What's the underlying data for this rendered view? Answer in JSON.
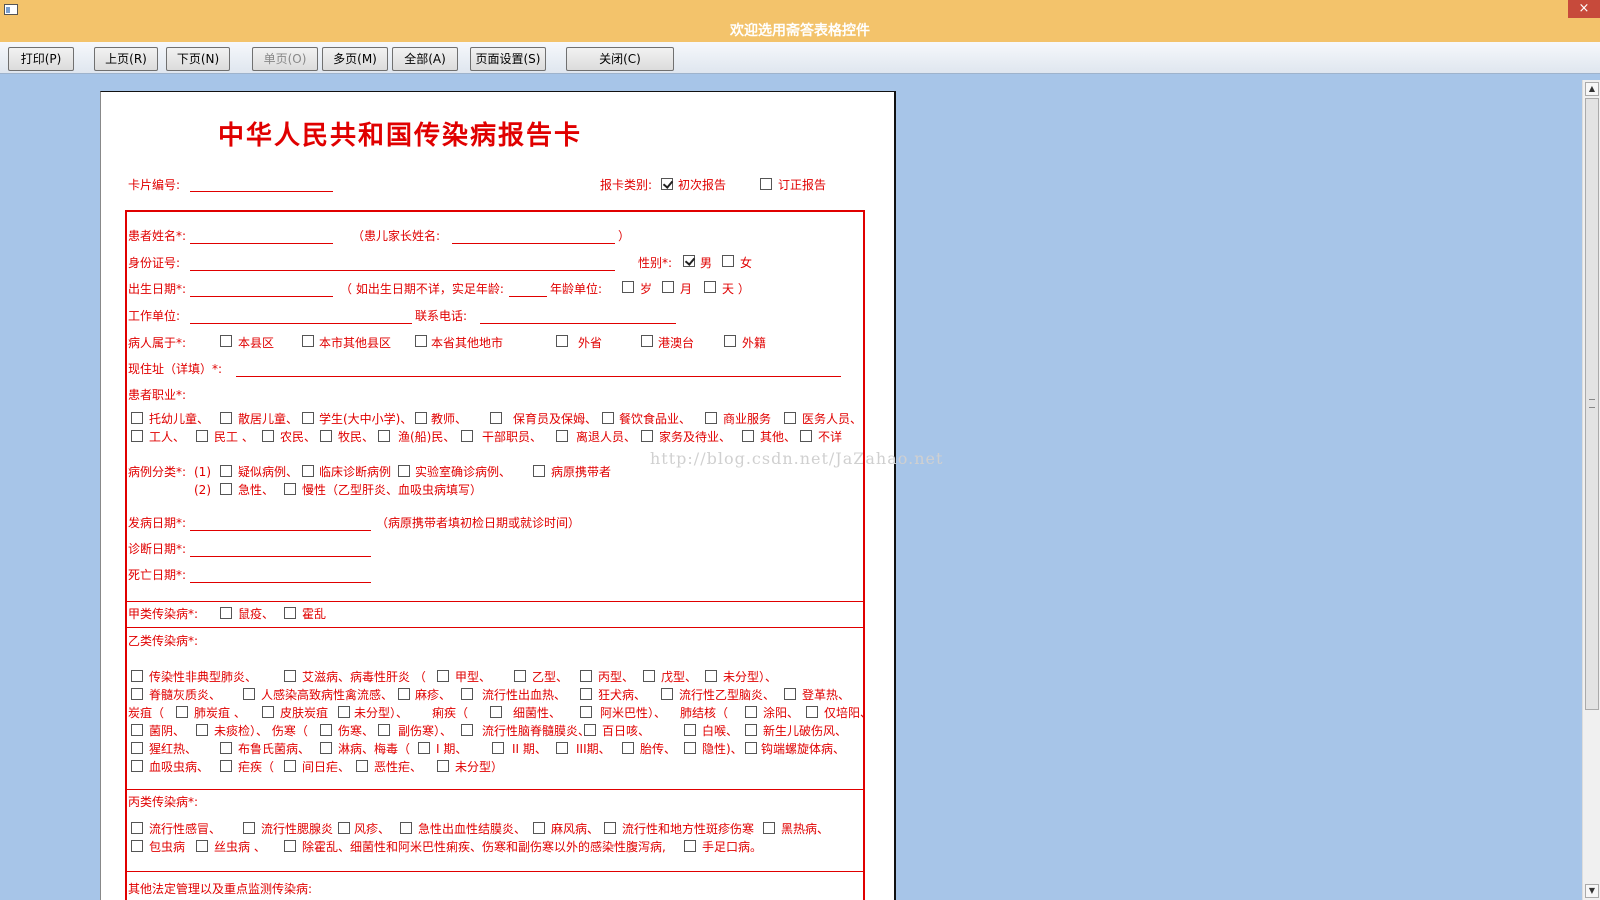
{
  "window": {
    "title": "欢迎选用斋答表格控件",
    "close_label": "×"
  },
  "toolbar": {
    "print": "打印(P)",
    "prev": "上页(R)",
    "next": "下页(N)",
    "single": "单页(O)",
    "multi": "多页(M)",
    "all": "全部(A)",
    "page_setup": "页面设置(S)",
    "close": "关闭(C)"
  },
  "doc": {
    "title": "中华人民共和国传染病报告卡",
    "card_no_label": "卡片编号:",
    "report_type_label": "报卡类别:",
    "initial_report": "初次报告",
    "revised_report": "订正报告",
    "patient_name_label": "患者姓名*:",
    "guardian_label": "（患儿家长姓名:",
    "close_paren": "）",
    "id_label": "身份证号:",
    "sex_label": "性别*:",
    "male": "男",
    "female": "女",
    "birth_label": "出生日期*:",
    "birth_note": "（ 如出生日期不详，实足年龄:",
    "age_unit_label": "年龄单位:",
    "year": "岁",
    "month": "月",
    "day": "天 ）",
    "work_label": "工作单位:",
    "phone_label": "联系电话:",
    "belong_label": "病人属于*:",
    "belong_opts": [
      "本县区",
      "本市其他县区",
      "本省其他地市",
      "外省",
      "港澳台",
      "外籍"
    ],
    "address_label": "现住址（详填）*:",
    "occupation_label": "患者职业*:",
    "occ_row1": [
      "托幼儿童、",
      "散居儿童、",
      "学生(大中小学)、",
      "教师、",
      "保育员及保姆、",
      "餐饮食品业、",
      "商业服务",
      "医务人员、"
    ],
    "occ_row2": [
      "工人、",
      "民工 、",
      "农民、",
      "牧民、",
      "渔(船)民、",
      "干部职员、",
      "离退人员、",
      "家务及待业、",
      "其他、",
      "不详"
    ],
    "case_class_label": "病例分类*:",
    "cc_1": "(1)",
    "cc_2": "(2)",
    "cc_row1": [
      "疑似病例、",
      "临床诊断病例",
      "实验室确诊病例、",
      "病原携带者"
    ],
    "cc_row2": [
      "急性、",
      "慢性（乙型肝炎、血吸虫病填写）"
    ],
    "onset_label": "发病日期*:",
    "onset_note": "（病原携带者填初检日期或就诊时间）",
    "diag_label": "诊断日期*:",
    "death_label": "死亡日期*:",
    "class_a_label": "甲类传染病*:",
    "class_a": [
      "鼠疫、",
      "霍乱"
    ],
    "class_b_label": "乙类传染病*:",
    "b_r1": [
      "传染性非典型肺炎、",
      "艾滋病、病毒性肝炎 （",
      "甲型、",
      "乙型、",
      "丙型、",
      "戊型、",
      "未分型）、"
    ],
    "b_r2": [
      "脊髓灰质炎、",
      "人感染高致病性禽流感、",
      "麻疹、",
      "流行性出血热、",
      "狂犬病、",
      "流行性乙型脑炎、",
      "登革热、"
    ],
    "b_r3_head": "炭疽（",
    "b_r3": [
      "肺炭疽 、",
      "皮肤炭疽",
      "未分型）、",
      "痢疾（",
      "细菌性、",
      "阿米巴性）、",
      "肺结核（",
      "涂阳、",
      "仅培阳、"
    ],
    "b_r4": [
      "菌阴、",
      "未痰检）、 伤寒（",
      "伤寒、",
      "副伤寒）、",
      "流行性脑脊髓膜炎、",
      "百日咳、",
      "白喉、",
      "新生儿破伤风、"
    ],
    "b_r5": [
      "猩红热、",
      "布鲁氏菌病、",
      "淋病、梅毒（",
      "I 期、",
      "II 期、",
      "III期、",
      "胎传、",
      "隐性)、",
      "钩端螺旋体病、"
    ],
    "b_r6": [
      "血吸虫病、",
      "疟疾（",
      "间日疟、",
      "恶性疟、",
      "未分型）"
    ],
    "class_c_label": "丙类传染病*:",
    "c_r1": [
      "流行性感冒、",
      "流行性腮腺炎",
      "风疹、",
      "急性出血性结膜炎、",
      "麻风病、",
      "流行性和地方性斑疹伤寒",
      "黑热病、"
    ],
    "c_r2": [
      "包虫病",
      "丝虫病 、",
      "除霍乱、细菌性和阿米巴性痢疾、伤寒和副伤寒以外的感染性腹泻病,",
      "手足口病。"
    ],
    "other_label": "其他法定管理以及重点监测传染病:"
  },
  "watermark": "http://blog.csdn.net/JaZahao.net"
}
